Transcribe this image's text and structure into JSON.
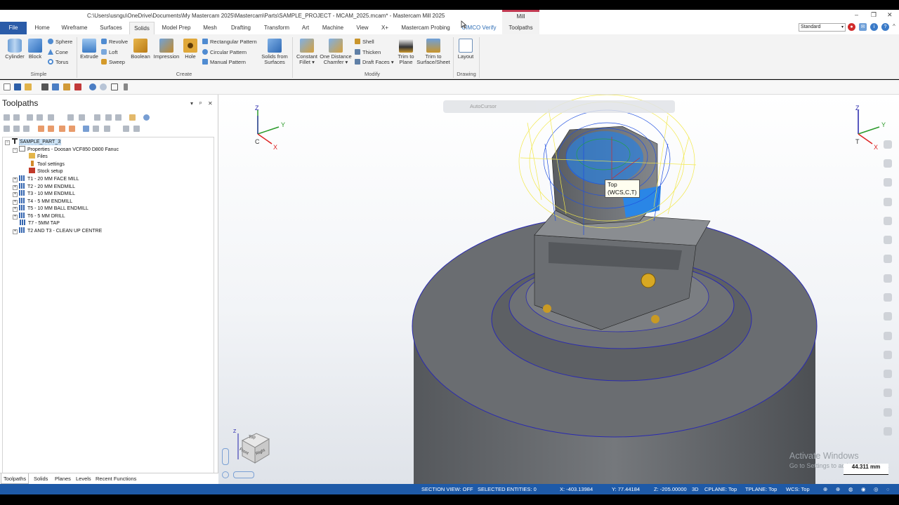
{
  "window": {
    "title": "C:\\Users\\usngu\\OneDrive\\Documents\\My Mastercam 2025\\Mastercam\\Parts\\SAMPLE_PROJECT - MCAM_2025.mcam* - Mastercam Mill 2025",
    "context_group": "Mill",
    "minimize": "–",
    "restore": "❐",
    "close": "✕"
  },
  "tabs": [
    {
      "label": "File"
    },
    {
      "label": "Home"
    },
    {
      "label": "Wireframe"
    },
    {
      "label": "Surfaces"
    },
    {
      "label": "Solids"
    },
    {
      "label": "Model Prep"
    },
    {
      "label": "Mesh"
    },
    {
      "label": "Drafting"
    },
    {
      "label": "Transform"
    },
    {
      "label": "Art"
    },
    {
      "label": "Machine"
    },
    {
      "label": "View"
    },
    {
      "label": "X+"
    },
    {
      "label": "Mastercam Probing"
    },
    {
      "label": "CIMCO Verify"
    },
    {
      "label": "Toolpaths"
    }
  ],
  "toolbar_right": {
    "style_select": "Standard",
    "collapse": "^"
  },
  "ribbon": {
    "simple": {
      "label": "Simple",
      "cylinder": "Cylinder",
      "block": "Block",
      "sphere": "Sphere",
      "cone": "Cone",
      "torus": "Torus"
    },
    "create": {
      "label": "Create",
      "extrude": "Extrude",
      "revolve": "Revolve",
      "loft": "Loft",
      "sweep": "Sweep",
      "boolean": "Boolean",
      "impression": "Impression",
      "hole": "Hole",
      "rect_pattern": "Rectangular Pattern",
      "circ_pattern": "Circular Pattern",
      "manual_pattern": "Manual Pattern",
      "solids_from_surfaces_1": "Solids from",
      "solids_from_surfaces_2": "Surfaces"
    },
    "modify": {
      "label": "Modify",
      "constant_fillet_1": "Constant",
      "constant_fillet_2": "Fillet ▾",
      "one_distance_1": "One Distance",
      "one_distance_2": "Chamfer ▾",
      "shell": "Shell",
      "thicken": "Thicken",
      "draft_faces": "Draft Faces ▾",
      "trim_plane_1": "Trim to",
      "trim_plane_2": "Plane",
      "trim_surface_1": "Trim to",
      "trim_surface_2": "Surface/Sheet"
    },
    "drawing": {
      "label": "Drawing",
      "layout": "Layout"
    }
  },
  "panel": {
    "title": "Toolpaths",
    "pin": "▾",
    "autohide": "ᵖ",
    "close": "✕",
    "tree": {
      "root": "SAMPLE_PART_3",
      "properties": "Properties - Doosan VCF850 D800 Fanuc",
      "files": "Files",
      "tool_settings": "Tool settings",
      "stock_setup": "Stock setup",
      "ops": [
        "T1 - 20 MM FACE MILL",
        "T2 - 20 MM ENDMILL",
        "T3 - 10 MM ENDMILL",
        "T4 - 5 MM ENDMILL",
        "T5 - 10 MM BALL ENDMILL",
        "T6 - 5 MM DRILL",
        "T7 - 5MM TAP",
        "T2 AND T3 - CLEAN UP CENTRE"
      ]
    },
    "bottom_tabs": [
      "Toolpaths",
      "Solids",
      "Planes",
      "Levels",
      "Recent Functions"
    ]
  },
  "viewport": {
    "autocursor": "AutoCursor",
    "view_tip_1": "Top",
    "view_tip_2": "(WCS,C,T)",
    "triad_left": {
      "z": "Z",
      "y": "Y",
      "x": "X",
      "c": "C"
    },
    "triad_right": {
      "z": "Z",
      "y": "Y",
      "x": "X",
      "t": "T"
    },
    "cube": {
      "z": "Z",
      "top": "Top",
      "front": "Front",
      "right": "Right"
    },
    "watermark_1": "Activate Windows",
    "watermark_2": "Go to Settings to activate Windows.",
    "scale": "44.311 mm"
  },
  "status": {
    "section_view": "SECTION VIEW: OFF",
    "selected": "SELECTED ENTITIES: 0",
    "x": "X:   -403.13984",
    "y": "Y:   77.44184",
    "z": "Z:   -205.00000",
    "mode": "3D",
    "cplane": "CPLANE: Top",
    "tplane": "TPLANE: Top",
    "wcs": "WCS: Top"
  },
  "colors": {
    "file_tab": "#2a5ba8",
    "status_bar": "#1e5aa8",
    "mill_context": "#c23a52",
    "toolpath_blue": "#1f4fe0",
    "toolpath_yellow": "#f2e84a",
    "part_grey": "#6b6e72"
  }
}
